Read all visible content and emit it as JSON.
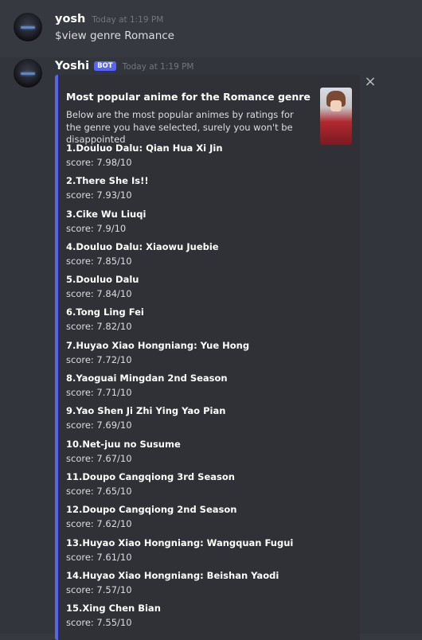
{
  "messages": [
    {
      "username": "yosh",
      "timestamp": "Today at 1:19 PM",
      "content": "$view genre Romance"
    },
    {
      "username": "Yoshi",
      "bot_tag": "BOT",
      "timestamp": "Today at 1:19 PM",
      "embed": {
        "accent_color": "#5865f2",
        "title": "Most popular anime for the Romance genre",
        "description": "Below are the most popular animes by ratings for the genre you have selected, surely you won't be disappointed",
        "items": [
          {
            "name": "1.Douluo Dalu: Qian Hua Xi Jin",
            "score": "score: 7.98/10"
          },
          {
            "name": "2.There She Is!!",
            "score": "score: 7.93/10"
          },
          {
            "name": "3.Cike Wu Liuqi",
            "score": "score: 7.9/10"
          },
          {
            "name": "4.Douluo Dalu: Xiaowu Juebie",
            "score": "score: 7.85/10"
          },
          {
            "name": "5.Douluo Dalu",
            "score": "score: 7.84/10"
          },
          {
            "name": "6.Tong Ling Fei",
            "score": "score: 7.82/10"
          },
          {
            "name": "7.Huyao Xiao Hongniang: Yue Hong",
            "score": "score: 7.72/10"
          },
          {
            "name": "8.Yaoguai Mingdan 2nd Season",
            "score": "score: 7.71/10"
          },
          {
            "name": "9.Yao Shen Ji Zhi Ying Yao Pian",
            "score": "score: 7.69/10"
          },
          {
            "name": "10.Net-juu no Susume",
            "score": "score: 7.67/10"
          },
          {
            "name": "11.Doupo Cangqiong 3rd Season",
            "score": "score: 7.65/10"
          },
          {
            "name": "12.Doupo Cangqiong 2nd Season",
            "score": "score: 7.62/10"
          },
          {
            "name": "13.Huyao Xiao Hongniang: Wangquan Fugui",
            "score": "score: 7.61/10"
          },
          {
            "name": "14.Huyao Xiao Hongniang: Beishan Yaodi",
            "score": "score: 7.57/10"
          },
          {
            "name": "15.Xing Chen Bian",
            "score": "score: 7.55/10"
          }
        ]
      }
    }
  ],
  "icons": {
    "close": "close-icon",
    "close_glyph": "×"
  }
}
